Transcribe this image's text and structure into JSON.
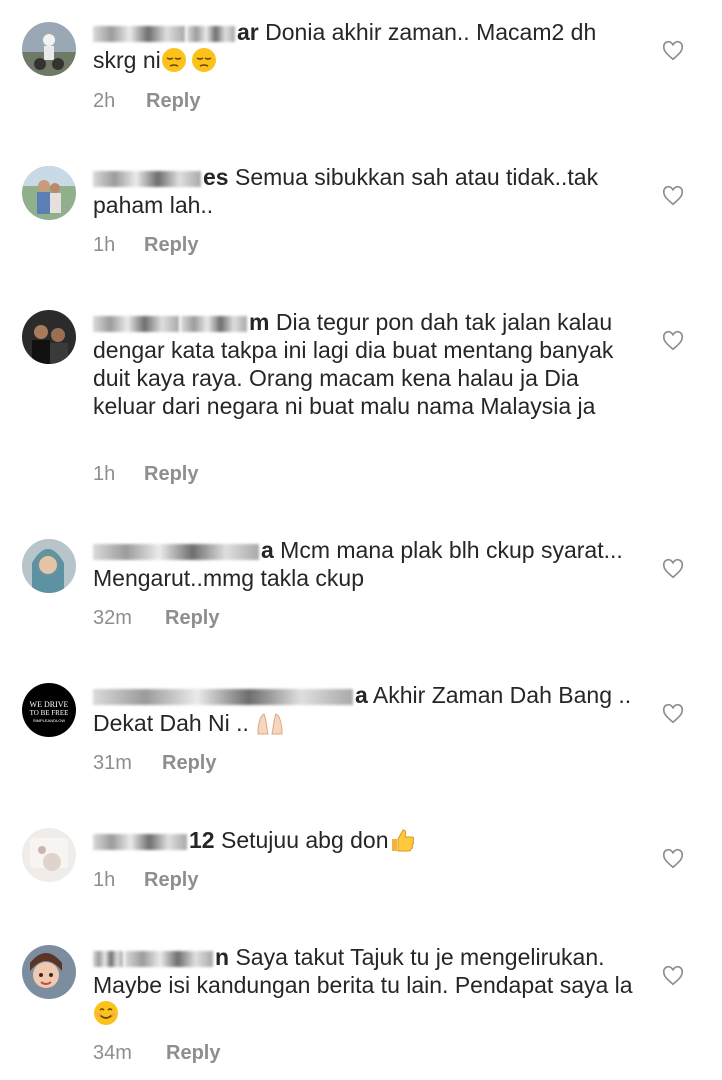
{
  "reply_label": "Reply",
  "comments": [
    {
      "user_visible": "ar",
      "text": " Donia akhir zaman.. Macam2 dh skrg ni",
      "time": "2h"
    },
    {
      "user_visible": "es",
      "text": " Semua sibukkan sah atau tidak..tak paham lah..",
      "time": "1h"
    },
    {
      "user_visible": "m",
      "text": " Dia tegur pon dah tak jalan kalau dengar kata takpa ini lagi dia buat mentang banyak duit kaya raya. Orang macam kena halau ja Dia keluar dari negara ni buat malu nama Malaysia ja",
      "time": "1h"
    },
    {
      "user_visible": "a",
      "text": " Mcm mana plak blh ckup syarat... Mengarut..mmg takla ckup",
      "time": "32m"
    },
    {
      "user_visible": "a",
      "text": " Akhir Zaman Dah Bang .. Dekat Dah Ni .. ",
      "time": "31m"
    },
    {
      "user_visible": "12",
      "text": " Setujuu abg don",
      "time": "1h"
    },
    {
      "user_visible": "n",
      "text": " Saya takut Tajuk tu je mengelirukan. Maybe isi kandungan berita tu lain. Pendapat saya la",
      "time": "34m"
    }
  ],
  "avatar_logo": {
    "line1": "WE DRIVE",
    "line2": "TO BE FREE",
    "line3": "SIMPLEANDLOW"
  },
  "colors": {
    "text": "#262626",
    "meta": "#8e8e8e",
    "background": "#ffffff"
  }
}
